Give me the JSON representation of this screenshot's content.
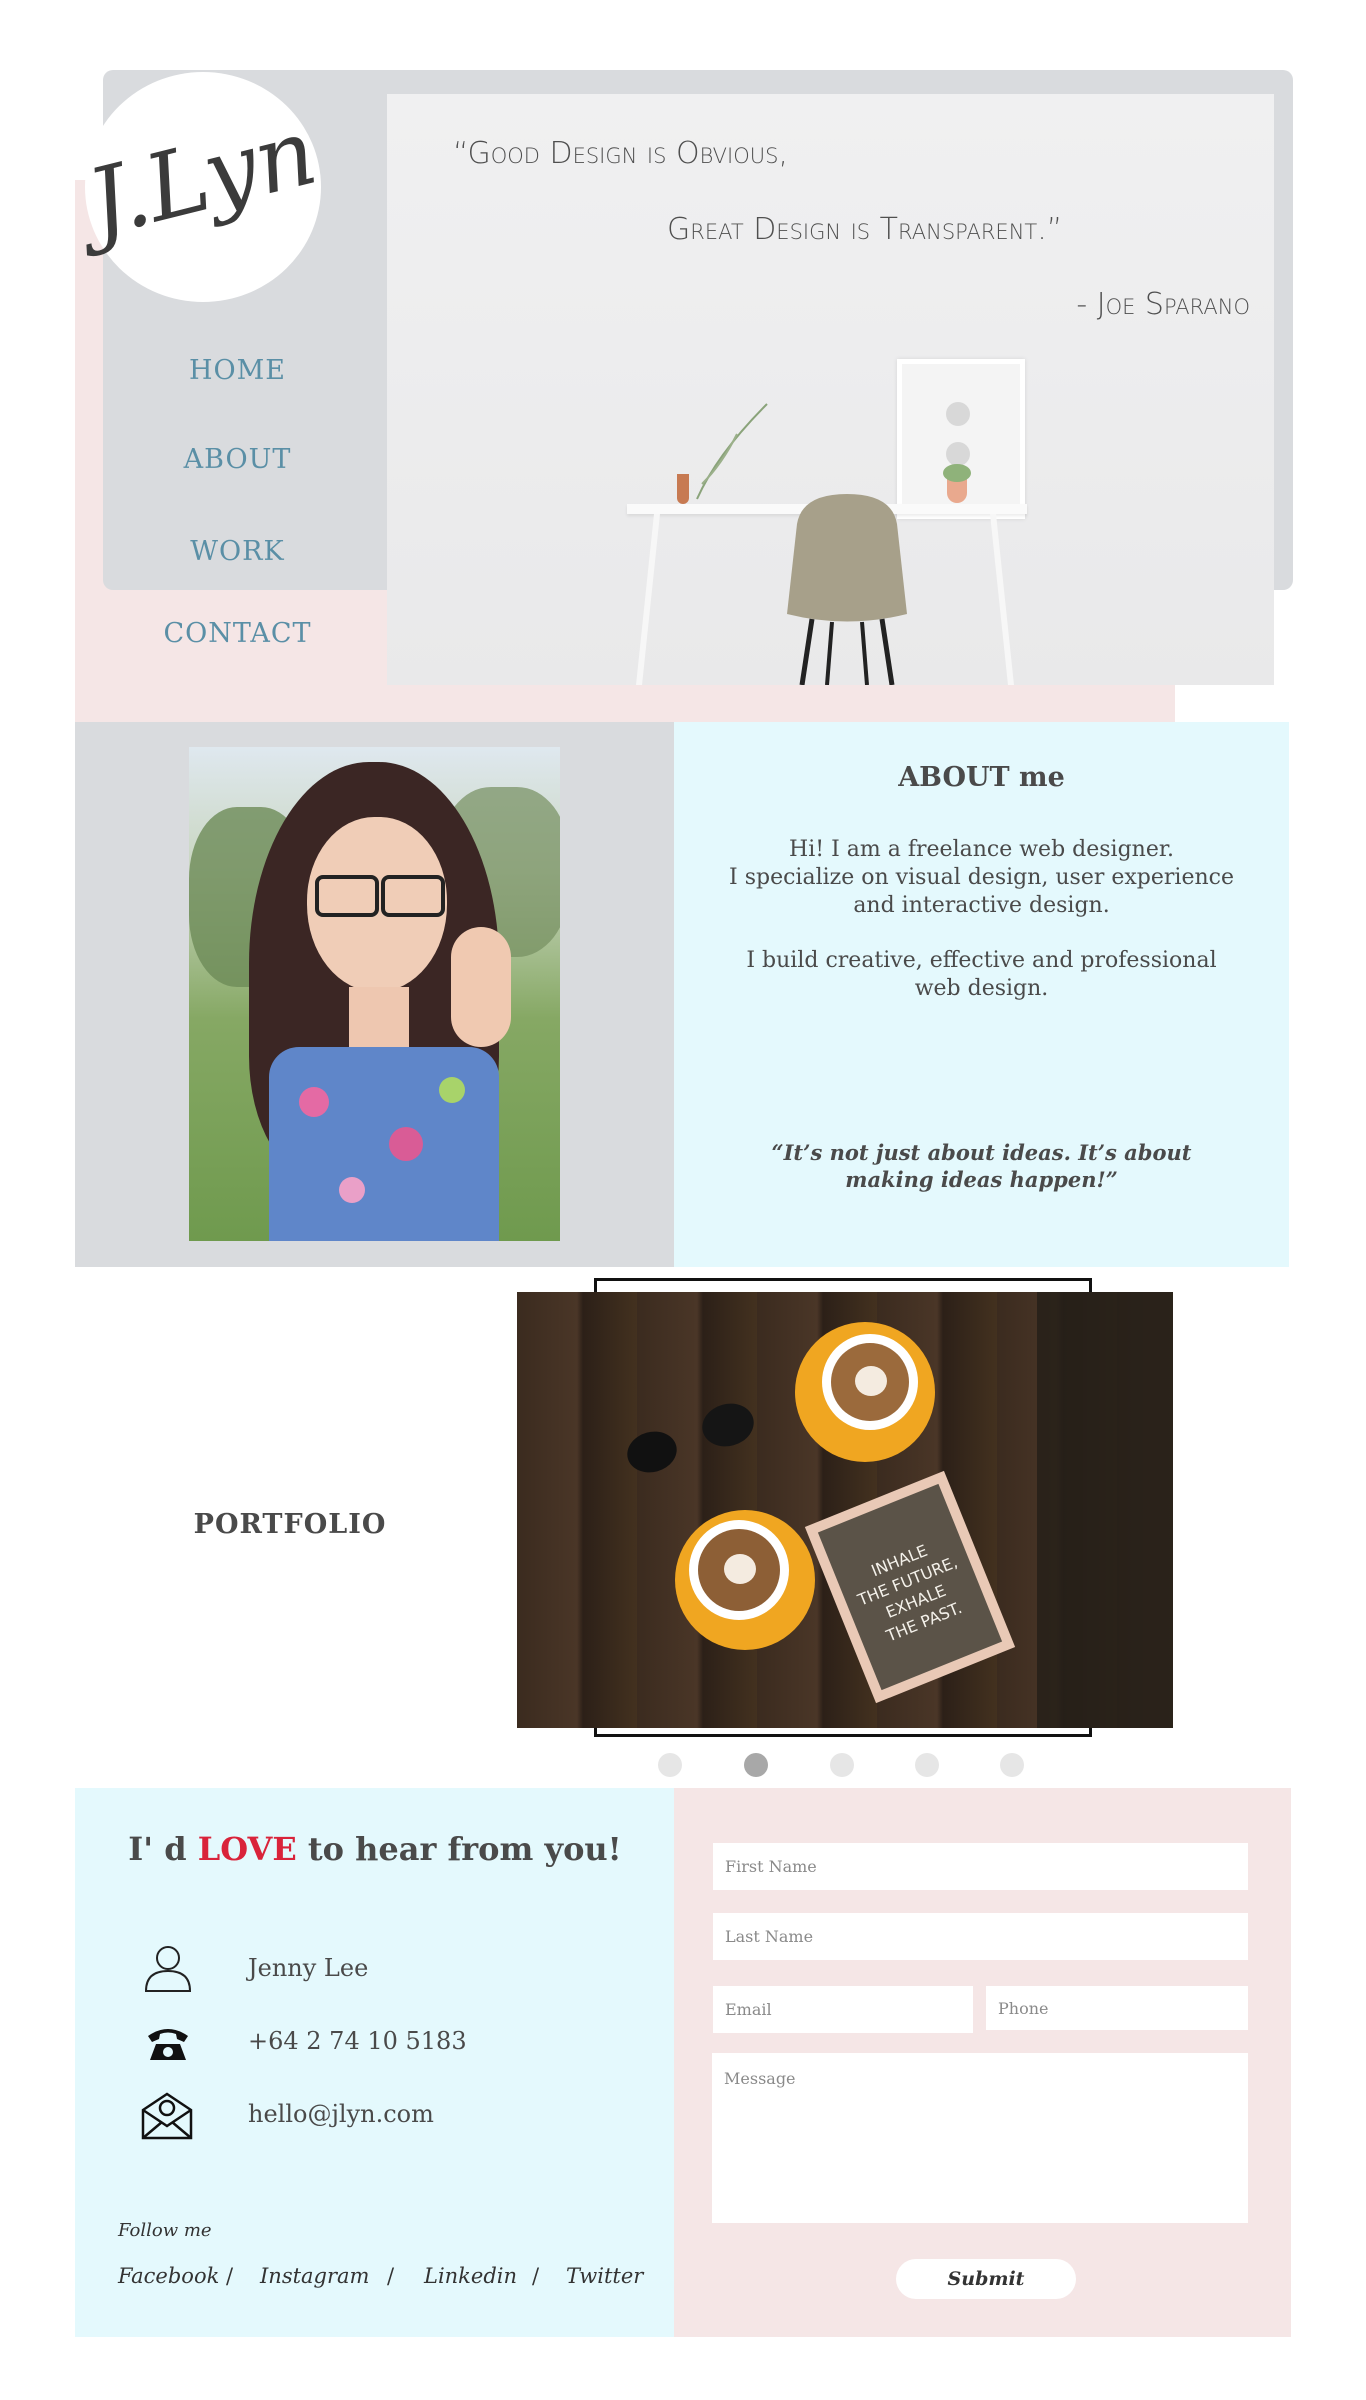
{
  "header": {
    "logo_text": "J.Lyn",
    "nav": [
      "HOME",
      "ABOUT",
      "WORK",
      "CONTACT"
    ],
    "quote_line1": "“Good Design is Obvious,",
    "quote_line2": "Great Design is Transparent.”",
    "quote_author": "- Joe Sparano"
  },
  "about": {
    "title": "ABOUT me",
    "line1": "Hi! I am a freelance web designer.",
    "line2": "I specialize on visual design, user experience",
    "line3": "and interactive design.",
    "line4": "I build creative, effective and professional",
    "line5": "web design.",
    "quote": "“It’s not just about ideas. It’s about making ideas happen!”"
  },
  "portfolio": {
    "label": "PORTFOLIO",
    "slide_sign": [
      "INHALE",
      "THE FUTURE,",
      "EXHALE",
      "THE PAST."
    ],
    "dots": 5,
    "active_dot": 2
  },
  "contact": {
    "heading_pre": "I' d ",
    "heading_love": "LOVE",
    "heading_post": " to hear from you!",
    "name": "Jenny Lee",
    "phone": "+64 2 74 10 5183",
    "email": "hello@jlyn.com",
    "follow_label": "Follow me",
    "social": [
      "Facebook",
      "Instagram",
      "Linkedin",
      "Twitter"
    ],
    "social_sep": "/",
    "form": {
      "first_name_placeholder": "First Name",
      "last_name_placeholder": "Last Name",
      "email_placeholder": "Email",
      "phone_placeholder": "Phone",
      "message_placeholder": "Message",
      "submit_label": "Submit"
    }
  },
  "colors": {
    "nav": "#5a8fa6",
    "love": "#d9233a",
    "panel_grey": "#d9dbde",
    "panel_blue": "#e4f9fd",
    "panel_pink": "#f5e6e6"
  }
}
